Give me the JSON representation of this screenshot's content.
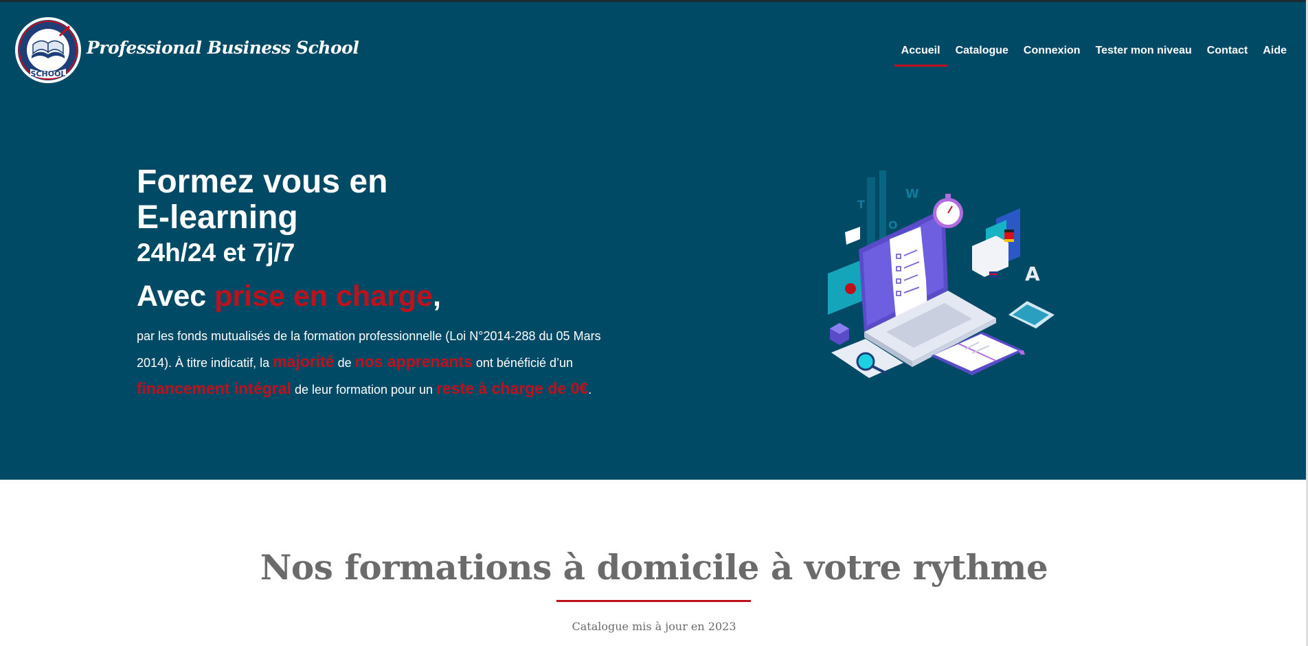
{
  "header": {
    "brand": "Professional Business School",
    "logo_text_top": "PROFESSIONAL BUSINESS",
    "logo_text_bottom": "SCHOOL"
  },
  "nav": {
    "items": [
      {
        "label": "Accueil",
        "active": true
      },
      {
        "label": "Catalogue"
      },
      {
        "label": "Connexion"
      },
      {
        "label": "Tester mon niveau"
      },
      {
        "label": "Contact"
      },
      {
        "label": "Aide"
      }
    ]
  },
  "hero": {
    "line1": "Formez vous en",
    "line2": "E-learning",
    "line3": "24h/24 et 7j/7",
    "avec": "Avec ",
    "prise": "prise en charge",
    "comma": ",",
    "p_part1": "par les fonds mutualisés de la formation professionnelle (Loi N°2014-288 du 05 Mars 2014). À titre indicatif, la ",
    "p_majorite": "majorité",
    "p_de": " de ",
    "p_apprenants": "nos apprenants",
    "p_part2": " ont bénéficié d’un ",
    "p_financement": "financement intégral",
    "p_part3": " de leur formation pour un ",
    "p_reste": "reste à charge de 0€",
    "p_end": "."
  },
  "section": {
    "title": "Nos formations à domicile à votre rythme",
    "subtitle": "Catalogue mis à jour en 2023"
  },
  "colors": {
    "hero_bg": "#004a66",
    "accent_red": "#c0101b",
    "title_gray": "#6b6b6b"
  }
}
